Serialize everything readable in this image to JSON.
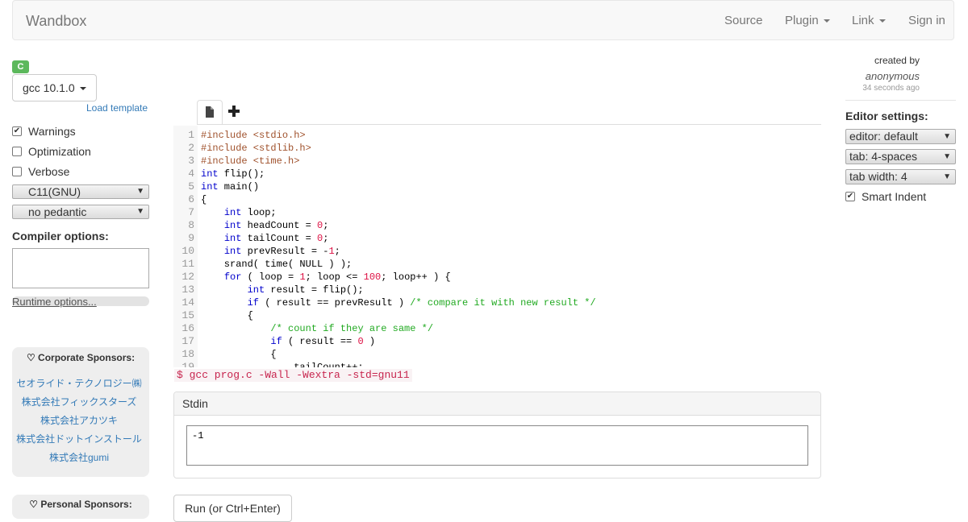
{
  "navbar": {
    "brand": "Wandbox",
    "links": [
      "Source",
      "Plugin",
      "Link",
      "Sign in"
    ]
  },
  "compiler": {
    "language_badge": "C",
    "selected": "gcc 10.1.0",
    "load_template": "Load template",
    "options": [
      {
        "label": "Warnings",
        "checked": true
      },
      {
        "label": "Optimization",
        "checked": false
      },
      {
        "label": "Verbose",
        "checked": false
      }
    ],
    "std_select": "C11(GNU)",
    "pedantic_select": "no pedantic",
    "compiler_options_label": "Compiler options:",
    "runtime_options_label": "Runtime options..."
  },
  "sponsors": {
    "corporate_title": "Corporate Sponsors:",
    "corporate": [
      "セオライド・テクノロジー㈱",
      "株式会社フィックスターズ",
      "株式会社アカツキ",
      "株式会社ドットインストール",
      "株式会社gumi"
    ],
    "personal_title": "Personal Sponsors:"
  },
  "editor": {
    "file_icon": "file-icon",
    "add_icon": "plus-icon",
    "lines": [
      [
        [
          "meta",
          "#include <stdio.h>"
        ]
      ],
      [
        [
          "meta",
          "#include <stdlib.h>"
        ]
      ],
      [
        [
          "meta",
          "#include <time.h>"
        ]
      ],
      [
        [
          "kw",
          "int"
        ],
        [
          "plain",
          " flip();"
        ]
      ],
      [
        [
          "kw",
          "int"
        ],
        [
          "plain",
          " main()"
        ]
      ],
      [
        [
          "plain",
          "{"
        ]
      ],
      [
        [
          "plain",
          "    "
        ],
        [
          "kw",
          "int"
        ],
        [
          "plain",
          " loop;"
        ]
      ],
      [
        [
          "plain",
          "    "
        ],
        [
          "kw",
          "int"
        ],
        [
          "plain",
          " headCount = "
        ],
        [
          "num",
          "0"
        ],
        [
          "plain",
          ";"
        ]
      ],
      [
        [
          "plain",
          "    "
        ],
        [
          "kw",
          "int"
        ],
        [
          "plain",
          " tailCount = "
        ],
        [
          "num",
          "0"
        ],
        [
          "plain",
          ";"
        ]
      ],
      [
        [
          "plain",
          "    "
        ],
        [
          "kw",
          "int"
        ],
        [
          "plain",
          " prevResult = -"
        ],
        [
          "num",
          "1"
        ],
        [
          "plain",
          ";"
        ]
      ],
      [
        [
          "plain",
          "    srand( time( NULL ) );"
        ]
      ],
      [
        [
          "plain",
          "    "
        ],
        [
          "kw",
          "for"
        ],
        [
          "plain",
          " ( loop = "
        ],
        [
          "num",
          "1"
        ],
        [
          "plain",
          "; loop <= "
        ],
        [
          "num",
          "100"
        ],
        [
          "plain",
          "; loop++ ) {"
        ]
      ],
      [
        [
          "plain",
          "        "
        ],
        [
          "kw",
          "int"
        ],
        [
          "plain",
          " result = flip();"
        ]
      ],
      [
        [
          "plain",
          "        "
        ],
        [
          "kw",
          "if"
        ],
        [
          "plain",
          " ( result == prevResult ) "
        ],
        [
          "cm",
          "/* compare it with new result */"
        ]
      ],
      [
        [
          "plain",
          "        {"
        ]
      ],
      [
        [
          "plain",
          "            "
        ],
        [
          "cm",
          "/* count if they are same */"
        ]
      ],
      [
        [
          "plain",
          "            "
        ],
        [
          "kw",
          "if"
        ],
        [
          "plain",
          " ( result == "
        ],
        [
          "num",
          "0"
        ],
        [
          "plain",
          " )"
        ]
      ],
      [
        [
          "plain",
          "            {"
        ]
      ],
      [
        [
          "plain",
          "                tailCount++;"
        ]
      ]
    ]
  },
  "command_line": "$ gcc prog.c -Wall -Wextra -std=gnu11",
  "stdin": {
    "title": "Stdin",
    "value": "-1"
  },
  "run_button": "Run (or Ctrl+Enter)",
  "meta": {
    "created_by": "created by",
    "author": "anonymous",
    "time_ago": "34 seconds ago"
  },
  "editor_settings": {
    "label": "Editor settings:",
    "selects": [
      "editor: default",
      "tab: 4-spaces",
      "tab width: 4"
    ],
    "smart_indent": {
      "label": "Smart Indent",
      "checked": true
    }
  }
}
